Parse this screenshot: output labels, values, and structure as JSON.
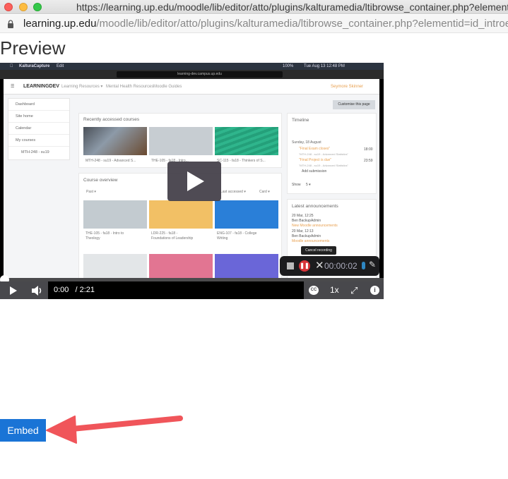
{
  "window": {
    "title_url": "https://learning.up.edu/moodle/lib/editor/atto/plugins/kalturamedia/ltibrowse_container.php?elementid=id_introeditor"
  },
  "address_bar": {
    "host": "learning.up.edu",
    "path": "/moodle/lib/editor/atto/plugins/kalturamedia/ltibrowse_container.php?elementid=id_introe"
  },
  "page": {
    "heading": "Preview",
    "embed_label": "Embed"
  },
  "video": {
    "mac_menubar": {
      "app": "KalturaCapture",
      "menu_edit": "Edit",
      "battery": "100%",
      "clock": "Tue Aug 13  12:48 PM"
    },
    "mini_url": "learning-dev.campus.up.edu",
    "moodle": {
      "brand": "LEARNINGDEV",
      "nav": [
        "Learning Resources ▾",
        "Mental Health Resources",
        "Moodle Guides"
      ],
      "user": "Seymore Skinner",
      "customise_button": "Customise this page",
      "sidebar": [
        "Dashboard",
        "Site home",
        "Calendar",
        "My courses",
        "MTH-248 - su19"
      ],
      "recent_title": "Recently accessed courses",
      "recent_courses": [
        "MTH-248 - su19 - Advanced S...",
        "THE-105 - fa18 - Intro...",
        "SC-115 - fa18 - Thinkers of S..."
      ],
      "overview_title": "Course overview",
      "overview_filter": "Past ▾",
      "overview_sort": "Last accessed ▾",
      "overview_view": "Card ▾",
      "overview_courses": [
        "THE-105 - fa18 - Intro to Theology",
        "LDR-225 - fa18 - Foundations of Leadership",
        "ENG-107 - fa18 - College Writing"
      ],
      "timeline_title": "Timeline",
      "timeline_date": "Sunday, 18 August",
      "timeline_items": [
        {
          "title": "\"Final Exam closes\"",
          "course": "\"MTH-248 - su19 - Advanced Statistics\"",
          "time": "18:00"
        },
        {
          "title": "\"Final Project is due\"",
          "course": "\"MTH-248 - su19 - Advanced Statistics\"",
          "time": "23:59"
        }
      ],
      "add_submission": "Add submission",
      "show_label": "Show",
      "show_value": "5 ▾",
      "announcements_title": "Latest announcements",
      "announcements": [
        {
          "date": "20 Mar, 12:25",
          "author": "Ben BackupAdmin",
          "title": "New Moodle announcements"
        },
        {
          "date": "20 Mar, 12:13",
          "author": "Ben BackupAdmin",
          "title": "Moodle announcements"
        }
      ]
    },
    "recorder": {
      "tooltip": "Cancel recording",
      "timer": "00:00:02"
    },
    "controls": {
      "current_time": "0:00",
      "duration": "/ 2:21",
      "speed": "1x",
      "progress": 0
    }
  }
}
